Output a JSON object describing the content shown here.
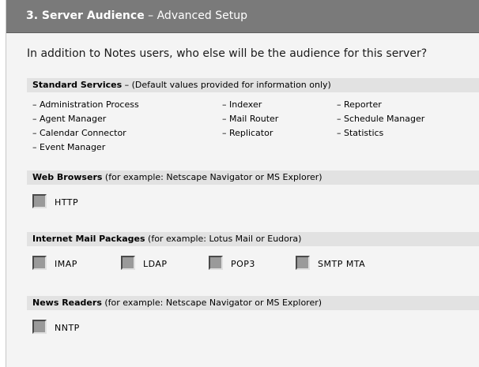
{
  "header": {
    "title_strong": "3. Server Audience",
    "title_rest": " – Advanced Setup"
  },
  "question": "In addition to Notes users, who else will be the audience for this server?",
  "standard_services": {
    "heading": "Standard Services",
    "note": " – (Default values provided for information only)",
    "col1": [
      "– Administration Process",
      "– Agent Manager",
      "– Calendar Connector",
      "– Event Manager"
    ],
    "col2": [
      "– Indexer",
      "– Mail Router",
      "– Replicator"
    ],
    "col3": [
      "– Reporter",
      "– Schedule Manager",
      "– Statistics"
    ]
  },
  "web_browsers": {
    "heading": "Web Browsers",
    "note": " (for example: Netscape Navigator or MS Explorer)",
    "options": [
      {
        "label": "HTTP",
        "checked": false
      }
    ]
  },
  "internet_mail": {
    "heading": "Internet Mail Packages",
    "note": " (for example: Lotus Mail or Eudora)",
    "options": [
      {
        "label": "IMAP",
        "checked": false
      },
      {
        "label": "LDAP",
        "checked": false
      },
      {
        "label": "POP3",
        "checked": false
      },
      {
        "label": "SMTP MTA",
        "checked": false
      }
    ]
  },
  "news_readers": {
    "heading": "News Readers",
    "note": " (for example: Netscape Navigator or MS Explorer)",
    "options": [
      {
        "label": "NNTP",
        "checked": false
      }
    ]
  }
}
